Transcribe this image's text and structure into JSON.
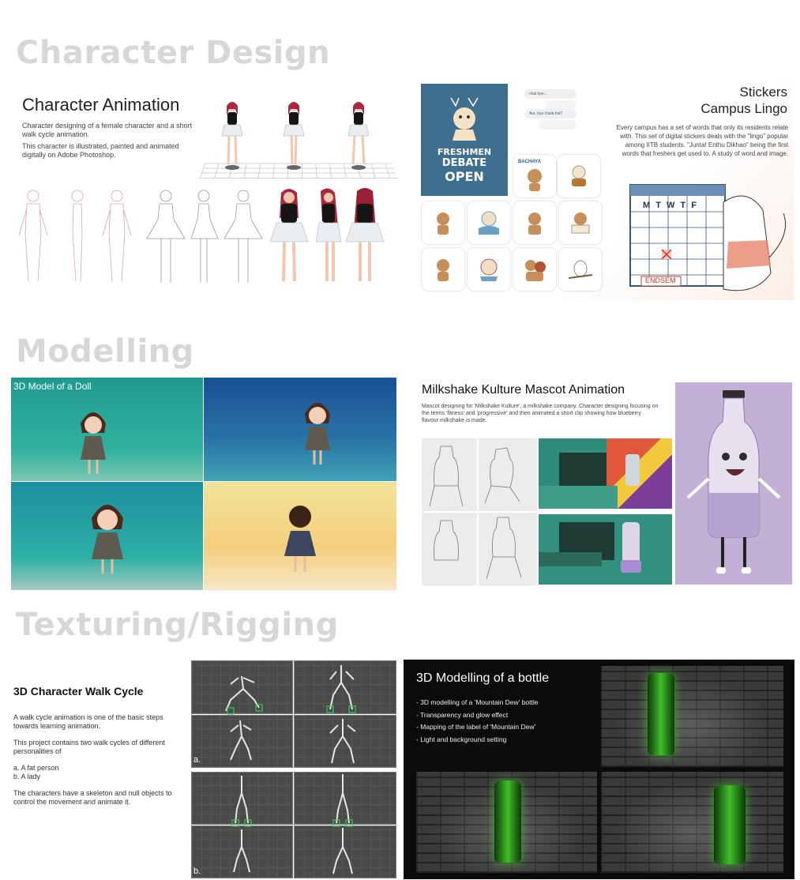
{
  "sections": {
    "character_design": "Character Design",
    "modelling": "Modelling",
    "texturing": "Texturing/Rigging"
  },
  "character_animation": {
    "title": "Character Animation",
    "desc1": "Character designing of a female character and a short walk cycle animation.",
    "desc2": "This character is illustrated, painted and animated digitally on Adobe Photoshop."
  },
  "stickers": {
    "title_line1": "Stickers",
    "title_line2": "Campus Lingo",
    "desc": "Every campus has a set of words that only its residents relate with. This set of digital stickers deals with the \"lingo\" popular among IITB students. \"Junta! Enthu Dikhao\" being the first words that freshers get used to. A study of word and image.",
    "poster_line1": "FRESHMEN",
    "poster_line2": "DEBATE",
    "poster_line3": "OPEN",
    "chat1": "chal bye...",
    "chat2": "Aur, kya chala hai?",
    "sticker_label": "BACHAYA",
    "calendar_days": "M T W T F",
    "calendar_label": "ENDSEM"
  },
  "doll": {
    "title": "3D Model of a Doll"
  },
  "milkshake": {
    "title": "Milkshake Kulture Mascot Animation",
    "desc": "Mascot designing for 'Milkshake Kulture', a milkshake company. Character designing focusing on the terms 'fitness' and 'progressive' and then animated a short clip showing how blueberry flavour milkshake is made."
  },
  "walk_cycle": {
    "title": "3D Character Walk Cycle",
    "p1": "A walk cycle animation is one of the basic steps towards learning animation.",
    "p2": "This project contains two walk cycles of different personalities of",
    "p3a": "a. A fat person",
    "p3b": "b. A lady",
    "p4": "The characters have a skeleton and null objects to control the movement and animate it.",
    "label_a": "a.",
    "label_b": "b."
  },
  "bottle": {
    "title": "3D Modelling of a bottle",
    "items": [
      "- 3D modelling of a 'Mountain Dew' bottle",
      "- Transparency and glow effect",
      "- Mapping of the label of 'Mountain Dew'",
      "- Light and background setting"
    ]
  }
}
